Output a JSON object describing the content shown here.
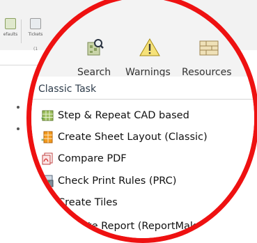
{
  "toolbar_bg": {
    "defaults_label": "efaults",
    "tickets_label": "Tickets",
    "sub_label": "(1"
  },
  "toolbar": {
    "search_label": "Search",
    "warnings_label": "Warnings",
    "resources_label": "Resources"
  },
  "section": {
    "title": "Classic Task"
  },
  "tasks": [
    {
      "label": "Step & Repeat CAD based",
      "icon": "step-repeat-icon"
    },
    {
      "label": "Create Sheet Layout (Classic)",
      "icon": "sheet-layout-icon"
    },
    {
      "label": "Compare PDF",
      "icon": "compare-pdf-icon"
    },
    {
      "label": "Check Print Rules (PRC)",
      "icon": "print-rules-icon"
    },
    {
      "label": "Create Tiles",
      "icon": "tiles-icon"
    },
    {
      "label": "ate Report (ReportMake",
      "icon": "report-icon"
    }
  ],
  "colors": {
    "highlight_circle": "#ee1111",
    "warning_yellow": "#f2c81a"
  }
}
